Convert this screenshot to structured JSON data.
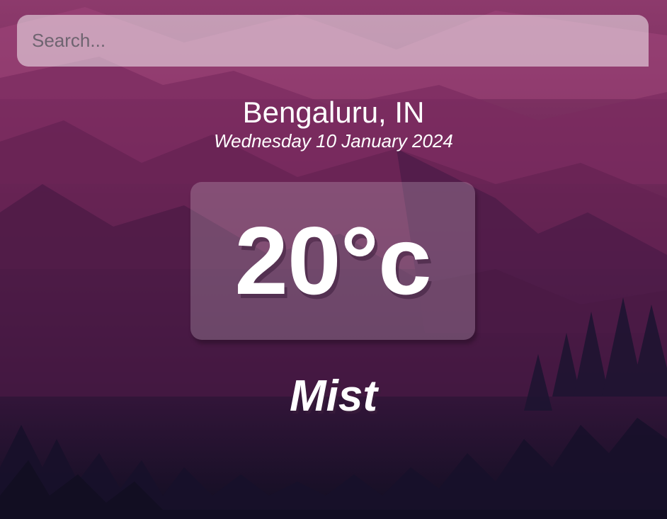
{
  "search": {
    "placeholder": "Search...",
    "value": ""
  },
  "location": {
    "city_country": "Bengaluru, IN",
    "date": "Wednesday 10 January 2024"
  },
  "weather": {
    "temperature": "20°c",
    "condition": "Mist"
  },
  "colors": {
    "bg_top": "#8a3567",
    "bg_mid": "#5a1f4d",
    "bg_bottom": "#120f24",
    "text": "#ffffff"
  }
}
